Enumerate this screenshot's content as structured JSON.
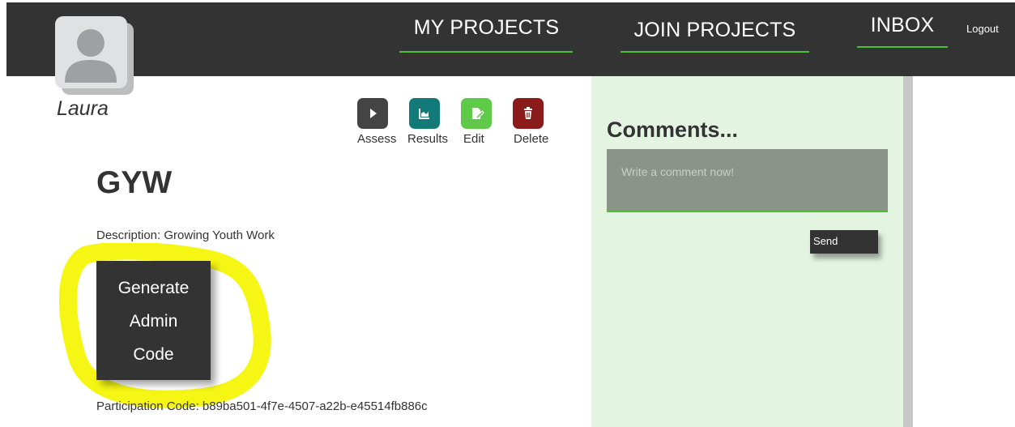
{
  "nav": {
    "my_projects": "MY PROJECTS",
    "join_projects": "JOIN PROJECTS",
    "inbox": "INBOX",
    "logout": "Logout"
  },
  "user": {
    "name": "Laura",
    "avatar_icon": "user-avatar-icon"
  },
  "actions": [
    {
      "label": "Assess",
      "icon": "play-icon",
      "color": "#444444"
    },
    {
      "label": "Results",
      "icon": "chart-icon",
      "color": "#137a7a"
    },
    {
      "label": "Edit",
      "icon": "edit-icon",
      "color": "#5fca48"
    },
    {
      "label": "Delete",
      "icon": "trash-icon",
      "color": "#8b1a1a"
    }
  ],
  "project": {
    "title": "GYW",
    "description": "Description: Growing Youth Work",
    "admin_button_lines": [
      "Generate",
      "Admin",
      "Code"
    ],
    "participation": "Participation Code: b89ba501-4f7e-4507-a22b-e45514fb886c"
  },
  "comments": {
    "title": "Comments...",
    "placeholder": "Write a comment now!",
    "send_label": "Send"
  },
  "colors": {
    "header_bg": "#333333",
    "accent_green": "#4fbf3a",
    "panel_bg": "#e3f5e1",
    "highlight": "#f5f500"
  }
}
